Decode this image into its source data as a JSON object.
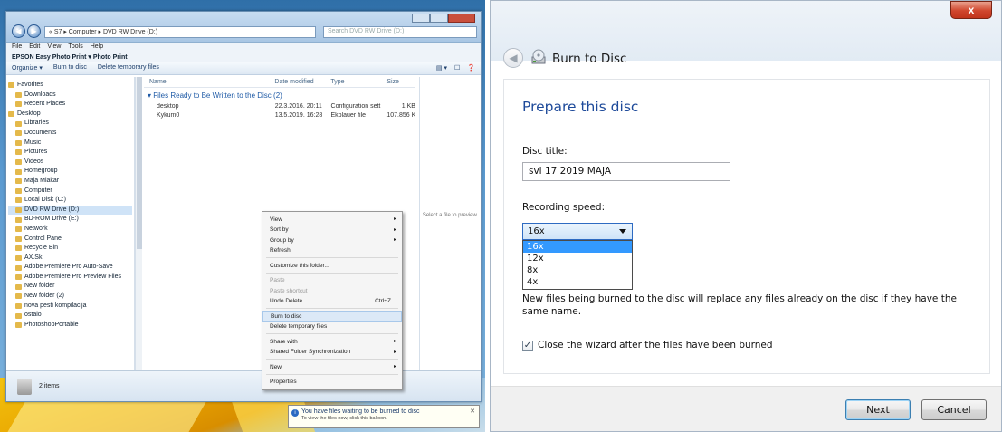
{
  "explorer": {
    "address": "« S7 ▸ Computer ▸ DVD RW Drive (D:)",
    "search_placeholder": "Search DVD RW Drive (D:)",
    "menu": [
      "File",
      "Edit",
      "View",
      "Tools",
      "Help"
    ],
    "epson_bar": "EPSON Easy Photo Print ▾  Photo Print",
    "toolbar": [
      "Organize ▾",
      "Burn to disc",
      "Delete temporary files"
    ],
    "nav_items": [
      {
        "label": "Favorites",
        "indent": 0
      },
      {
        "label": "Downloads",
        "indent": 1
      },
      {
        "label": "Recent Places",
        "indent": 1
      },
      {
        "label": "",
        "indent": 0
      },
      {
        "label": "Desktop",
        "indent": 0
      },
      {
        "label": "Libraries",
        "indent": 1
      },
      {
        "label": "Documents",
        "indent": 1
      },
      {
        "label": "Music",
        "indent": 1
      },
      {
        "label": "Pictures",
        "indent": 1
      },
      {
        "label": "Videos",
        "indent": 1
      },
      {
        "label": "Homegroup",
        "indent": 1
      },
      {
        "label": "Maja Mlakar",
        "indent": 1
      },
      {
        "label": "Computer",
        "indent": 1
      },
      {
        "label": "Local Disk (C:)",
        "indent": 1
      },
      {
        "label": "DVD RW Drive (D:)",
        "indent": 1
      },
      {
        "label": "BD-ROM Drive (E:)",
        "indent": 1
      },
      {
        "label": "Network",
        "indent": 1
      },
      {
        "label": "Control Panel",
        "indent": 1
      },
      {
        "label": "Recycle Bin",
        "indent": 1
      },
      {
        "label": "AX.Sk",
        "indent": 1
      },
      {
        "label": "Adobe Premiere Pro Auto-Save",
        "indent": 1
      },
      {
        "label": "Adobe Premiere Pro Preview Files",
        "indent": 1
      },
      {
        "label": "New folder",
        "indent": 1
      },
      {
        "label": "New folder (2)",
        "indent": 1
      },
      {
        "label": "nova pesti kompilacija",
        "indent": 1
      },
      {
        "label": "ostalo",
        "indent": 1
      },
      {
        "label": "PhotoshopPortable",
        "indent": 1
      }
    ],
    "columns": [
      "Name",
      "Date modified",
      "Type",
      "Size"
    ],
    "group": "▾ Files Ready to Be Written to the Disc (2)",
    "files": [
      {
        "name": "desktop",
        "date": "22.3.2016. 20:11",
        "type": "Configuration sett...",
        "size": "1 KB"
      },
      {
        "name": "Kykum0",
        "date": "13.5.2019. 16:28",
        "type": "Ekplauer file",
        "size": "107.856 KB"
      }
    ],
    "detail_pane": "Select a file to preview.",
    "status": "2 items",
    "context_menu": [
      {
        "label": "View",
        "arrow": true
      },
      {
        "label": "Sort by",
        "arrow": true
      },
      {
        "label": "Group by",
        "arrow": true
      },
      {
        "label": "Refresh"
      },
      {
        "sep": true
      },
      {
        "label": "Customize this folder..."
      },
      {
        "sep": true
      },
      {
        "label": "Paste",
        "disabled": true
      },
      {
        "label": "Paste shortcut",
        "disabled": true
      },
      {
        "label": "Undo Delete",
        "shortcut": "Ctrl+Z"
      },
      {
        "sep": true
      },
      {
        "label": "Burn to disc",
        "highlight": true
      },
      {
        "label": "Delete temporary files"
      },
      {
        "sep": true
      },
      {
        "label": "Share with",
        "arrow": true
      },
      {
        "label": "Shared Folder Synchronization",
        "arrow": true
      },
      {
        "sep": true
      },
      {
        "label": "New",
        "arrow": true
      },
      {
        "sep": true
      },
      {
        "label": "Properties"
      }
    ],
    "balloon": {
      "title": "You have files waiting to be burned to disc",
      "subtitle": "To view the files now, click this balloon."
    }
  },
  "burn_dialog": {
    "window_title": "Burn to Disc",
    "close_label": "x",
    "heading": "Prepare this disc",
    "disc_title_label": "Disc title:",
    "disc_title_value": "svi 17 2019 MAJA",
    "recording_speed_label": "Recording speed:",
    "selected_speed": "16x",
    "speed_options": [
      "16x",
      "12x",
      "8x",
      "4x"
    ],
    "warning_text": "New files being burned to the disc will replace any files already on the disc if they have the same name.",
    "close_wizard_label": "Close the wizard after the files have been burned",
    "close_wizard_checked": true,
    "next_label": "Next",
    "cancel_label": "Cancel"
  }
}
